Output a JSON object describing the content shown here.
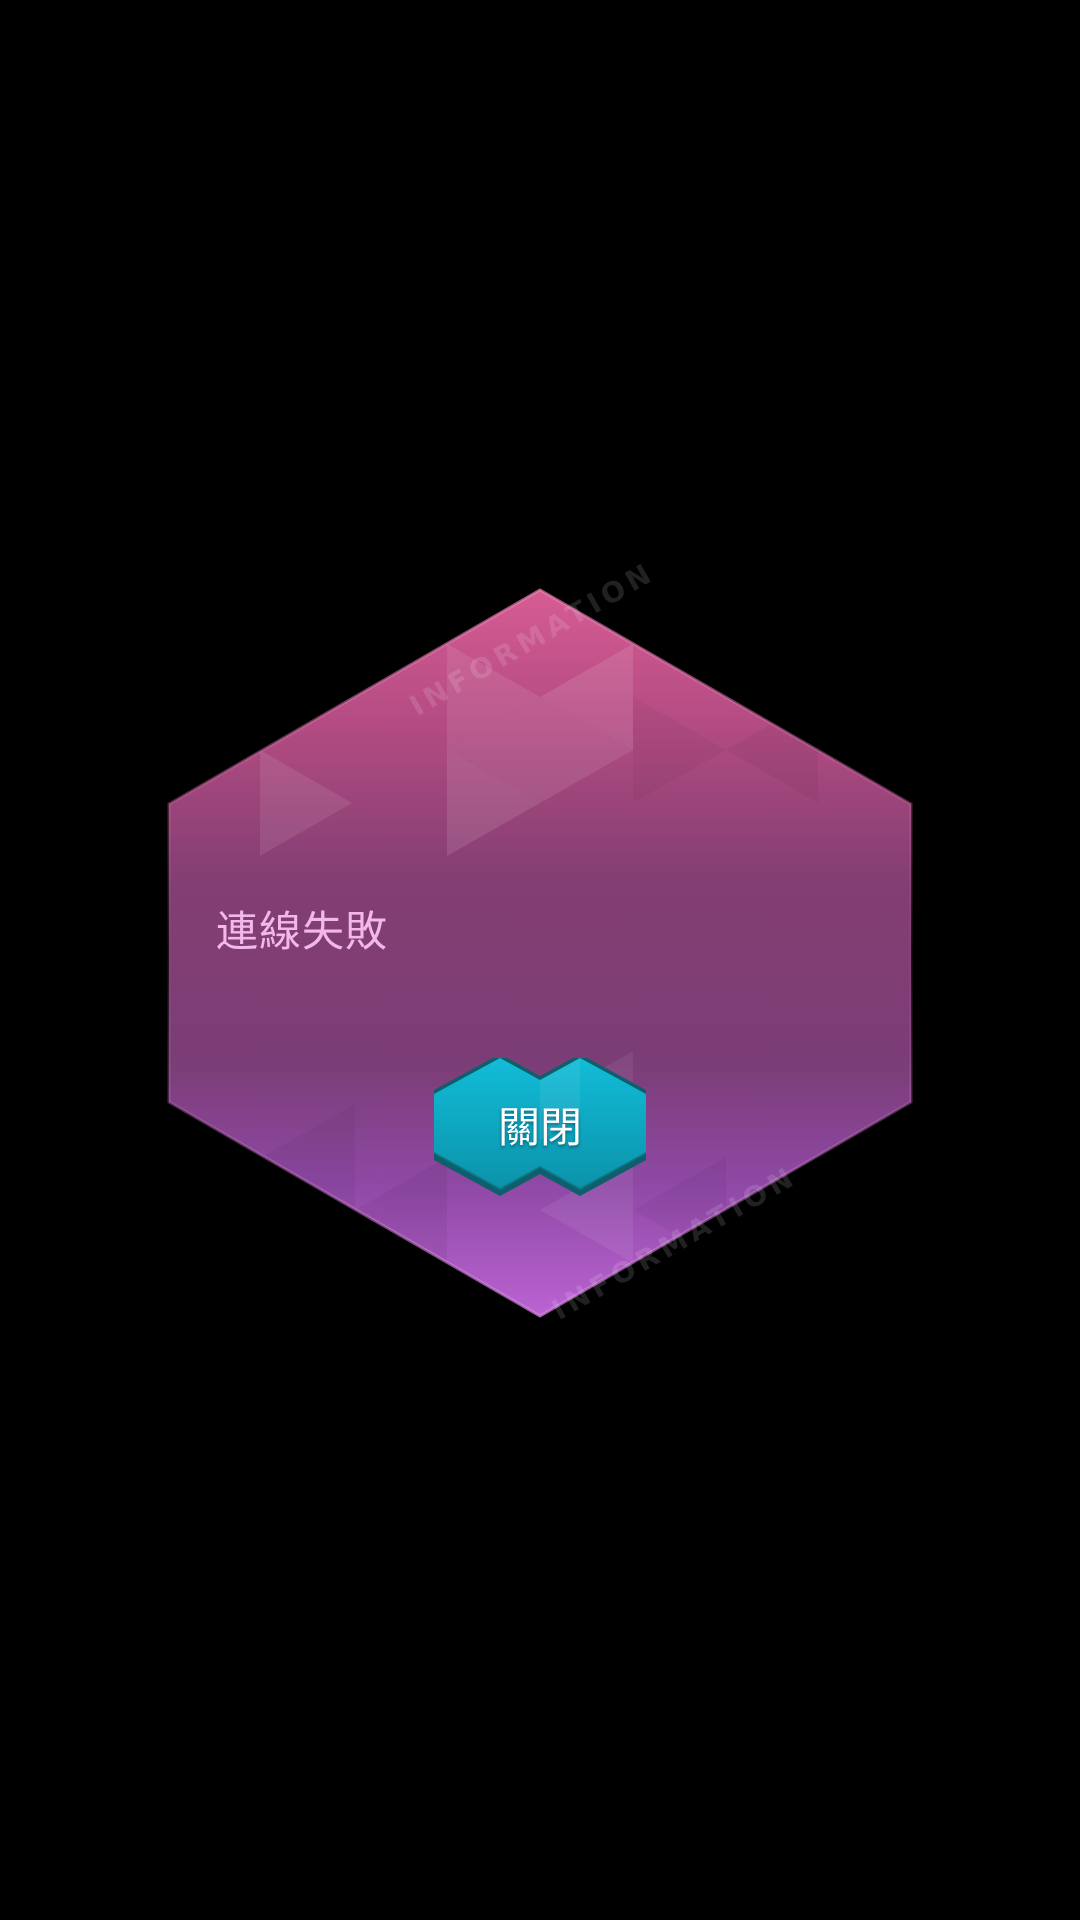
{
  "dialog": {
    "watermark": "INFORMATION",
    "message": "連線失敗",
    "close_label": "關閉"
  },
  "colors": {
    "background": "#000000",
    "panel_top": "#d25c95",
    "panel_mid": "#7f3d72",
    "panel_bottom": "#b25ec9",
    "message_text": "#f2b8ea",
    "button_top": "#12b5cf",
    "button_side": "#0f6d79"
  }
}
